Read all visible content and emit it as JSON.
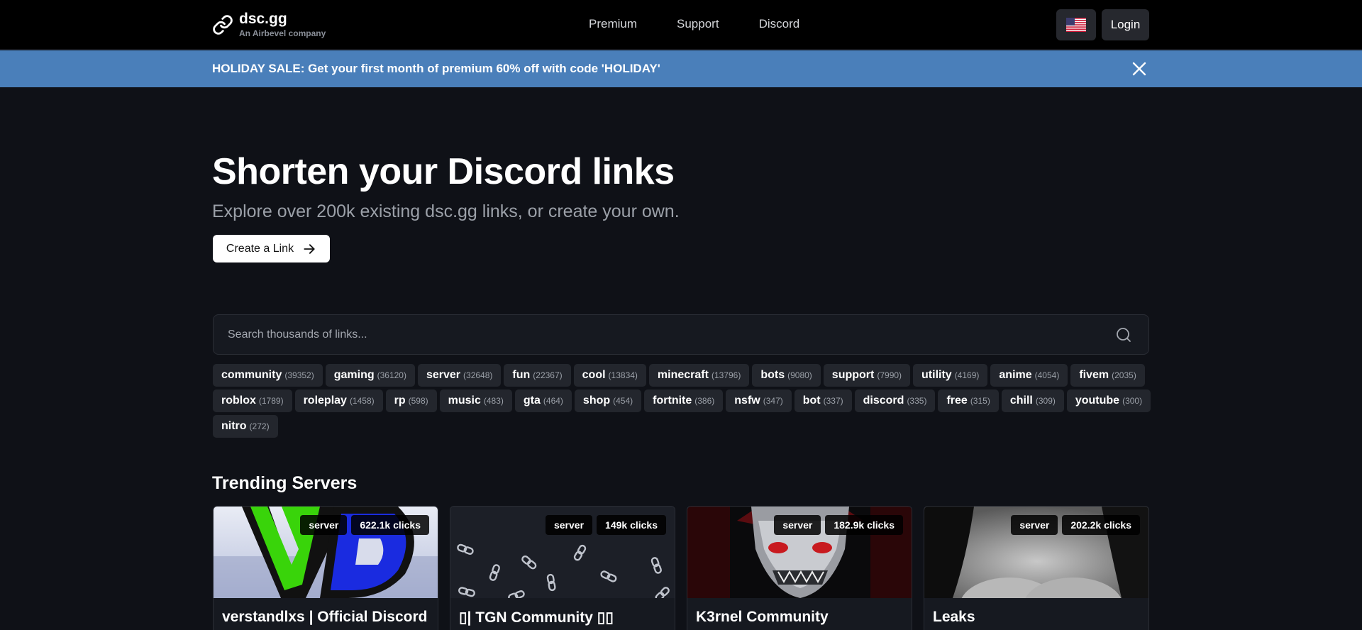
{
  "brand": {
    "name": "dsc.gg",
    "tagline": "An Airbevel company"
  },
  "nav": {
    "links": [
      "Premium",
      "Support",
      "Discord"
    ],
    "login_label": "Login",
    "language_flag": "us-flag-icon"
  },
  "banner": {
    "text": "HOLIDAY SALE: Get your first month of premium 60% off with code 'HOLIDAY'",
    "color": "#4a7fba"
  },
  "hero": {
    "title": "Shorten your Discord links",
    "subtitle": "Explore over 200k existing dsc.gg links, or create your own.",
    "cta_label": "Create a Link"
  },
  "search": {
    "placeholder": "Search thousands of links..."
  },
  "tags": [
    {
      "name": "community",
      "count": "(39352)"
    },
    {
      "name": "gaming",
      "count": "(36120)"
    },
    {
      "name": "server",
      "count": "(32648)"
    },
    {
      "name": "fun",
      "count": "(22367)"
    },
    {
      "name": "cool",
      "count": "(13834)"
    },
    {
      "name": "minecraft",
      "count": "(13796)"
    },
    {
      "name": "bots",
      "count": "(9080)"
    },
    {
      "name": "support",
      "count": "(7990)"
    },
    {
      "name": "utility",
      "count": "(4169)"
    },
    {
      "name": "anime",
      "count": "(4054)"
    },
    {
      "name": "fivem",
      "count": "(2035)"
    },
    {
      "name": "roblox",
      "count": "(1789)"
    },
    {
      "name": "roleplay",
      "count": "(1458)"
    },
    {
      "name": "rp",
      "count": "(598)"
    },
    {
      "name": "music",
      "count": "(483)"
    },
    {
      "name": "gta",
      "count": "(464)"
    },
    {
      "name": "shop",
      "count": "(454)"
    },
    {
      "name": "fortnite",
      "count": "(386)"
    },
    {
      "name": "nsfw",
      "count": "(347)"
    },
    {
      "name": "bot",
      "count": "(337)"
    },
    {
      "name": "discord",
      "count": "(335)"
    },
    {
      "name": "free",
      "count": "(315)"
    },
    {
      "name": "chill",
      "count": "(309)"
    },
    {
      "name": "youtube",
      "count": "(300)"
    },
    {
      "name": "nitro",
      "count": "(272)"
    }
  ],
  "trending": {
    "title": "Trending Servers",
    "cards": [
      {
        "title": "verstandlxs | Official Discord",
        "type": "server",
        "clicks": "622.1k clicks"
      },
      {
        "title": "▯| TGN Community ▯▯",
        "type": "server",
        "clicks": "149k clicks"
      },
      {
        "title": "K3rnel Community",
        "type": "server",
        "clicks": "182.9k clicks"
      },
      {
        "title": "Leaks",
        "type": "server",
        "clicks": "202.2k clicks"
      }
    ]
  }
}
